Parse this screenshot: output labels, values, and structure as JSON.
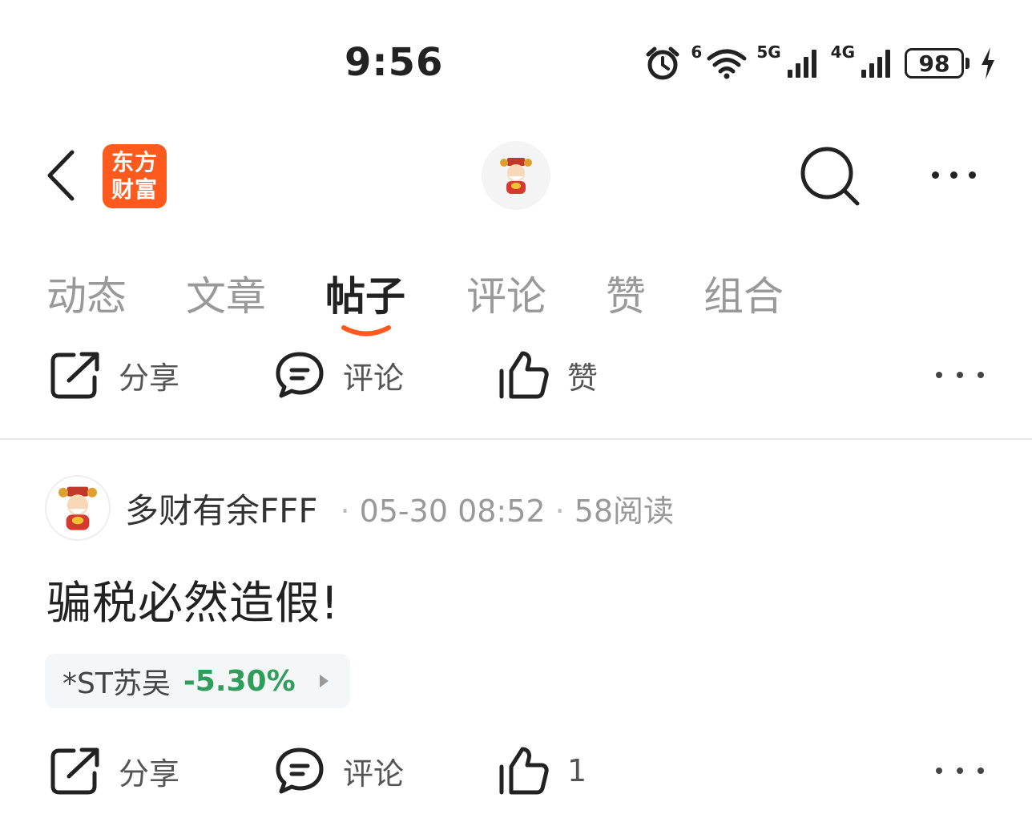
{
  "status_bar": {
    "time": "9:56",
    "wifi_label": "6",
    "sim1_label": "5G",
    "sim2_label": "4G",
    "battery": "98",
    "icons": [
      "alarm-icon",
      "wifi-icon",
      "signal-5g-icon",
      "signal-4g-icon",
      "battery-icon",
      "charging-icon"
    ]
  },
  "header": {
    "logo_line1": "东方",
    "logo_line2": "财富",
    "logo_color": "#ff5a1e",
    "icons": [
      "back-arrow-icon",
      "avatar-icon",
      "search-icon",
      "more-icon"
    ]
  },
  "tabs": [
    {
      "label": "动态",
      "active": false
    },
    {
      "label": "文章",
      "active": false
    },
    {
      "label": "帖子",
      "active": true
    },
    {
      "label": "评论",
      "active": false
    },
    {
      "label": "赞",
      "active": false
    },
    {
      "label": "组合",
      "active": false
    }
  ],
  "accent_color": "#ff5a1e",
  "top_actions": {
    "share": "分享",
    "comment": "评论",
    "like": "赞"
  },
  "post": {
    "author": "多财有余FFF",
    "time": "05-30 08:52",
    "reads": "58阅读",
    "title": "骗税必然造假!",
    "stock": {
      "name": "*ST苏吴",
      "change": "-5.30%",
      "change_color": "#2f9e5a"
    },
    "actions": {
      "share": "分享",
      "comment": "评论",
      "like_count": "1"
    }
  }
}
